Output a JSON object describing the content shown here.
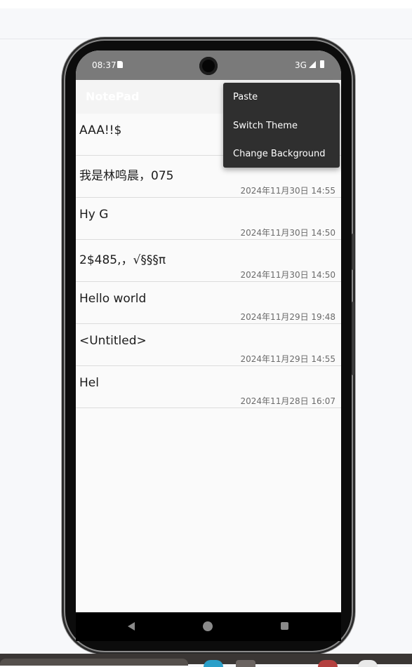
{
  "status_bar": {
    "time": "08:37",
    "network": "3G",
    "icons": [
      "sd-card-icon",
      "signal-icon",
      "battery-icon"
    ]
  },
  "app": {
    "title": "NotePad"
  },
  "menu": {
    "items": [
      {
        "label": "Paste"
      },
      {
        "label": "Switch Theme"
      },
      {
        "label": "Change Background"
      }
    ]
  },
  "notes": [
    {
      "title": "AAA!!$",
      "date": ""
    },
    {
      "title": "我是林鸣晨，075",
      "date": "2024年11月30日 14:55"
    },
    {
      "title": "Hy  G",
      "date": "2024年11月30日 14:50"
    },
    {
      "title": "2$485,，√§§§π",
      "date": "2024年11月30日 14:50"
    },
    {
      "title": "Hello world",
      "date": "2024年11月29日 19:48"
    },
    {
      "title": "<Untitled>",
      "date": "2024年11月29日 14:55"
    },
    {
      "title": "Hel",
      "date": "2024年11月28日 16:07"
    }
  ],
  "nav_bar": {
    "icons": [
      "back-icon",
      "home-icon",
      "recents-icon"
    ]
  },
  "colors": {
    "statusbar": "#7a7a7a",
    "menu_bg": "#2f2f2f",
    "divider": "#dcdcdc"
  }
}
